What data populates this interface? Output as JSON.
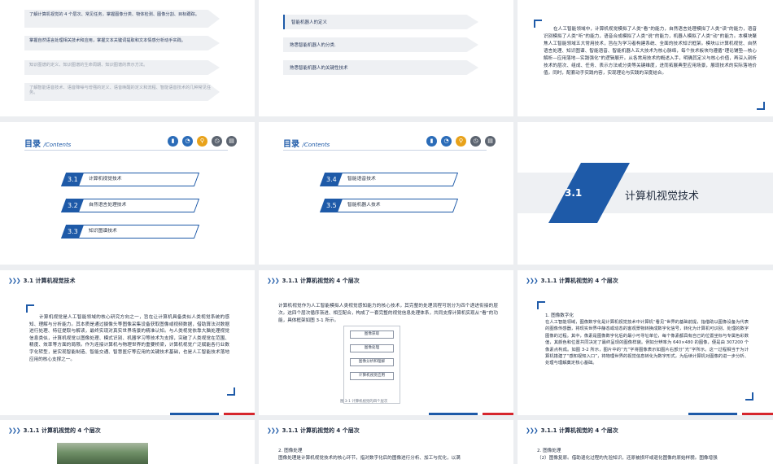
{
  "slide1": {
    "bands": [
      "了解计算机视觉的 4 个层次、常见任务，掌握图像分类、物体检测、图像分割、目标跟踪。",
      "掌握自然语言处理相关技术和应用，掌握文本关键词提取和文本情感分析动手实践。",
      "知识图谱的定义、知识图谱的生命周期、知识图谱的表示方法。",
      "了解智能语音技术、语音降噪与增强的定义、语音唤醒的定义和流程、智能语音技术的几种常见任务。"
    ]
  },
  "slide2": {
    "bands": [
      "智能机器人的定义",
      "熟悉智能机器人的分类.",
      "熟悉智能机器人的关键性技术"
    ]
  },
  "slide3": {
    "text": "在人工智能领域中，计算机视觉模拟了人类“看”的能力，自然语言处理模拟了人类“读”的能力，语音识别模拟了人类“听”的能力，语音合成模拟了人类“说”的能力，机器人模拟了人类“动”的能力。本模块聚焦人工智能领域五大常用技术，旨在为学习者构建系统、全面的技术知识框架。模块以计算机视觉、自然语言处理、知识图谱、智能语音、智能机器人五大技术为核心脉络，每个技术板块均遵循“理论铺垫—核心解析—应用落地—实践强化”的逻辑展开。从各常用技术的概述入手，明确其定义与核心价值，再深入剖析技术的层次、组成、任务、表示方法或分类等关键维度，进而拓展典型应用场景，展现技术的实际落地价值。同时，配套动手实践内容，实现理论与实践的深度结合。"
  },
  "toc": {
    "title": "目录",
    "title_en": "/Contents",
    "icons": [
      "chart-icon",
      "pie-icon",
      "search-icon",
      "clock-icon",
      "doc-icon"
    ],
    "left_items": [
      {
        "num": "3.1",
        "label": "计算机视觉技术"
      },
      {
        "num": "3.2",
        "label": "自然语言处理技术"
      },
      {
        "num": "3.3",
        "label": "知识图谱技术"
      }
    ],
    "right_items": [
      {
        "num": "3.4",
        "label": "智能语音技术"
      },
      {
        "num": "3.5",
        "label": "智能机器人技术"
      }
    ]
  },
  "cover": {
    "num": "3.1",
    "title": "计算机视觉技术"
  },
  "slide7": {
    "header": "3.1  计算机视觉技术",
    "text": "计算机视觉是人工智能领域的核心研究方向之一，旨在让计算机具备类似人类视觉系统的感知、理解与分析能力。其本质是通过摄像头等图像采集设备获取图像或视频数据，借助算法对数据进行处理、特征提取与解读，最终实现对真实世界场景的精准认知。与人类视觉依靠大脑处理视觉信息类似，计算机视觉以图像处理、模式识别、机器学习等技术为支撑，突破了人类视觉在范围、精度、效率等方面的局限。作为连接计算机与物理世界的重要桥梁，计算机视觉广泛赋能各行业数字化转型，是实现智能制造、智能交通、智慧医疗等应用的关键技术基础，也是人工智能技术落地应用的核心支撑之一。"
  },
  "slide8": {
    "header": "3.1.1 计算机视觉的 4 个层次",
    "text": "计算机视觉作为人工智能模拟人类视觉感知能力的核心技术，其完整的处理流程可划分为四个递进衔接的层次。这四个层次循序渐进、相互配合，构成了一套完整的视觉信息处理体系，共同支撑计算机实现从“看”的功能，具体框架如图 3-1 所示。",
    "flow": [
      "图像获取",
      "图像处理",
      "图像分析和理解",
      "计算机视觉应用"
    ],
    "caption": "图 3-1  计算机视觉的四个层次"
  },
  "slide9": {
    "header": "3.1.1 计算机视觉的 4 个层次",
    "subtitle": "1. 图像数字化",
    "text": "在人工智能领域，图像数字化是计算机视觉技术中计算机“看见”世界的基础前提，指借助以图像设备为代表的图像传感器，将现实世界中静态或动态的客观景物转换成数字化信号，转化为计算机可识别、处理的数字图像的过程。其中，像素是图像数字化后的最小可寻址单位，每个像素都具有自己的位置坐标与专属色彩数值，其颜色和位置共同决定了最终呈现的图像样貌。例如分辨率为 640×480 的图像，便是由 307200 个像素点构成。如图 3-2 所示，图片中的“光”字将图像表示如图片右部分“光”字所示。这一过程相当于为计算机搭建了“感知视知入口”，将物理世界的视觉信息转化为数字形式，为后续计算机对图像的进一步分析、处理与理解奠定核心基础。"
  },
  "slide10": {
    "header": "3.1.1 计算机视觉的 4 个层次"
  },
  "slide11": {
    "header": "3.1.1 计算机视觉的 4 个层次",
    "subtitle": "2. 图像处理",
    "text": "图像处理是计算机视觉技术的核心环节，指对数字化后的图像进行分析、加工与优化，以满"
  },
  "slide12": {
    "header": "3.1.1 计算机视觉的 4 个层次",
    "subtitle": "2. 图像处理",
    "text": "（2）图像复原。借助退化过程的先验知识，还原被损坏或退化图像的原始样貌。图像增强"
  },
  "colors": {
    "accent": "#1e5aa8",
    "red": "#d6262d",
    "icon1": "#2b6cb8",
    "icon2": "#2b6cb8",
    "icon3": "#e8a21a",
    "icon4": "#5c6470",
    "icon5": "#5c6470"
  }
}
